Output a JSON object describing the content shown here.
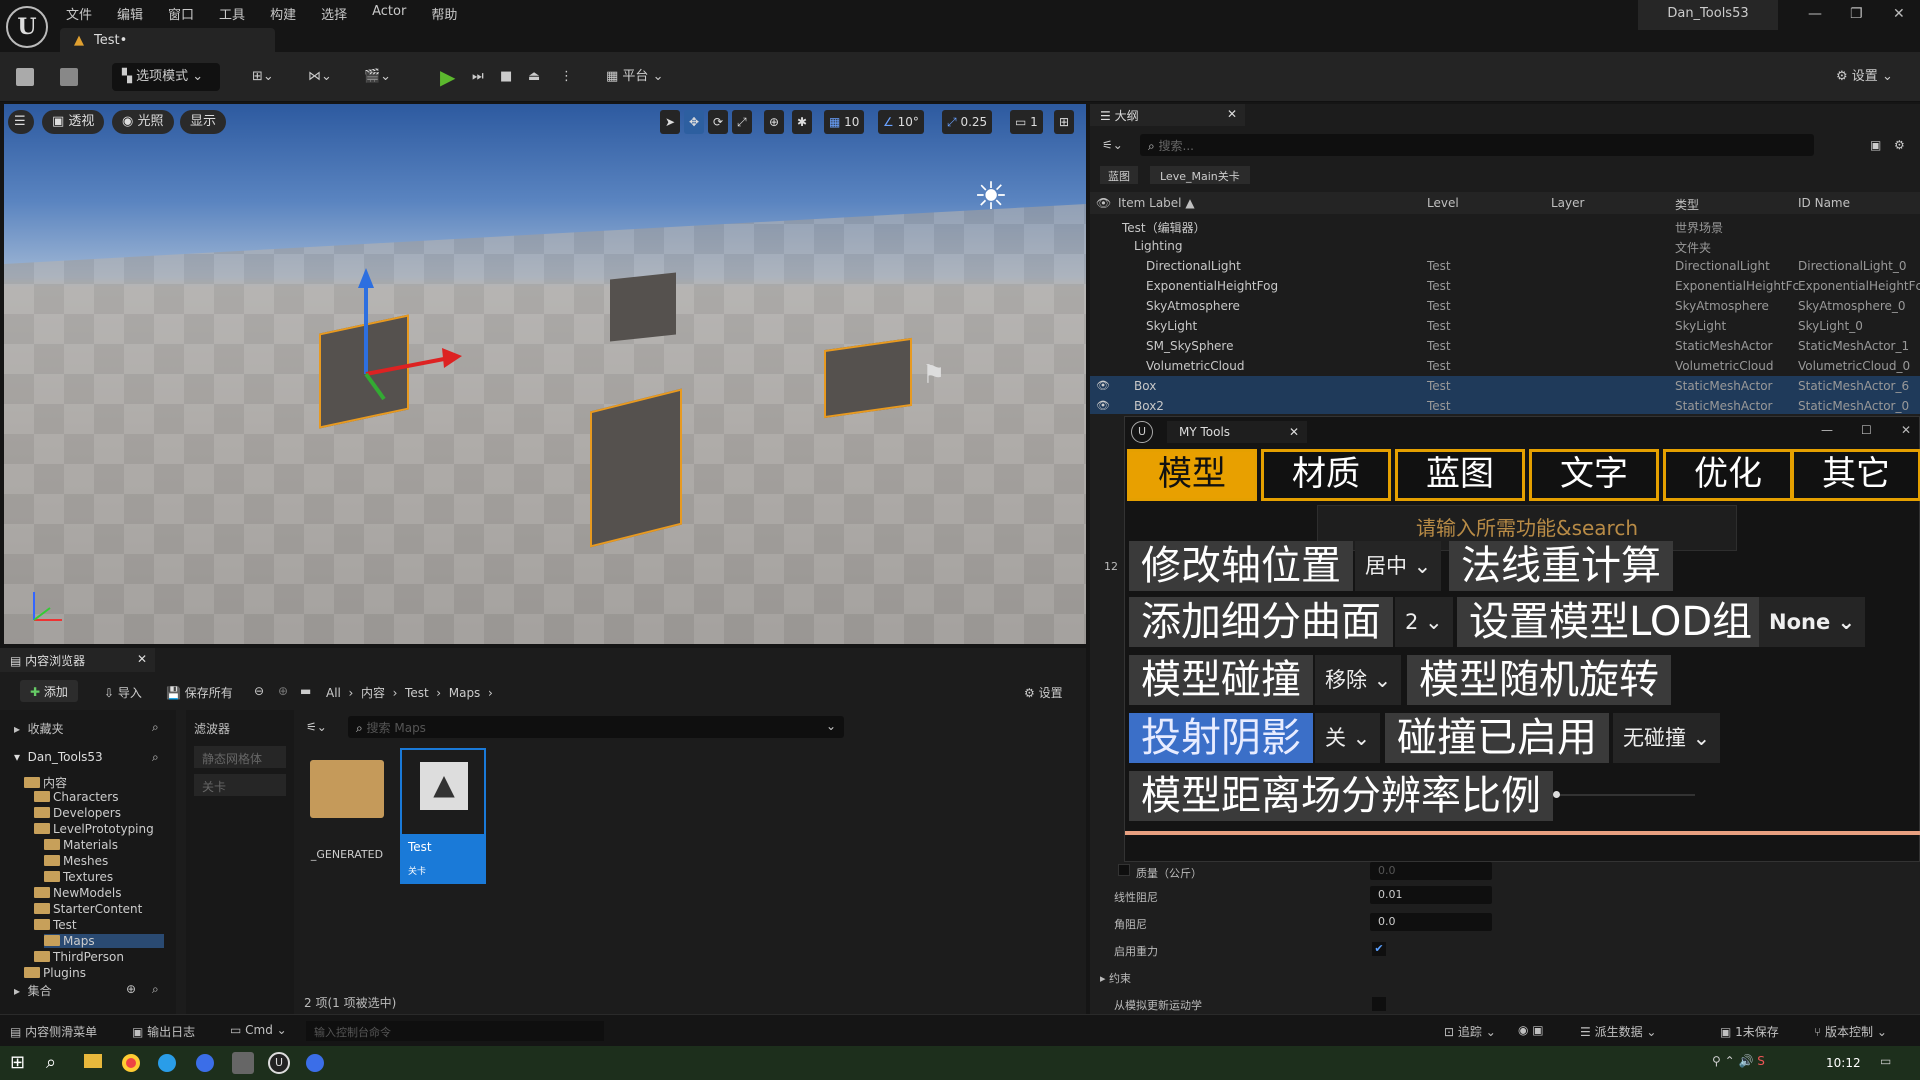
{
  "app": {
    "title_tab": "Test•",
    "project": "Dan_Tools53"
  },
  "menu": [
    "文件",
    "编辑",
    "窗口",
    "工具",
    "构建",
    "选择",
    "Actor",
    "帮助"
  ],
  "toolbar": {
    "mode": "选项模式",
    "platform": "平台",
    "settings": "设置"
  },
  "viewport": {
    "perspective": "透视",
    "lit": "光照",
    "show": "显示",
    "grid": "10",
    "angle": "10°",
    "scale": "0.25",
    "camera": "1"
  },
  "outliner": {
    "tab": "大纲",
    "search_placeholder": "搜索...",
    "filters": [
      "蓝图",
      "Leve_Main关卡"
    ],
    "columns": [
      "Item Label",
      "Level",
      "Layer",
      "类型",
      "ID Name"
    ],
    "rows": [
      {
        "label": "Test（编辑器）",
        "level": "",
        "type": "世界场景",
        "id": "",
        "sel": false,
        "indent": 1
      },
      {
        "label": "Lighting",
        "level": "",
        "type": "文件夹",
        "id": "",
        "sel": false,
        "indent": 2
      },
      {
        "label": "DirectionalLight",
        "level": "Test",
        "type": "DirectionalLight",
        "id": "DirectionalLight_0",
        "sel": false,
        "indent": 3
      },
      {
        "label": "ExponentialHeightFog",
        "level": "Test",
        "type": "ExponentialHeightFc",
        "id": "ExponentialHeightFc",
        "sel": false,
        "indent": 3
      },
      {
        "label": "SkyAtmosphere",
        "level": "Test",
        "type": "SkyAtmosphere",
        "id": "SkyAtmosphere_0",
        "sel": false,
        "indent": 3
      },
      {
        "label": "SkyLight",
        "level": "Test",
        "type": "SkyLight",
        "id": "SkyLight_0",
        "sel": false,
        "indent": 3
      },
      {
        "label": "SM_SkySphere",
        "level": "Test",
        "type": "StaticMeshActor",
        "id": "StaticMeshActor_1",
        "sel": false,
        "indent": 3
      },
      {
        "label": "VolumetricCloud",
        "level": "Test",
        "type": "VolumetricCloud",
        "id": "VolumetricCloud_0",
        "sel": false,
        "indent": 3
      },
      {
        "label": "Box",
        "level": "Test",
        "type": "StaticMeshActor",
        "id": "StaticMeshActor_6",
        "sel": true,
        "indent": 2
      },
      {
        "label": "Box2",
        "level": "Test",
        "type": "StaticMeshActor",
        "id": "StaticMeshActor_0",
        "sel": true,
        "indent": 2
      }
    ]
  },
  "details": {
    "mass": "质量（公斤）",
    "mass_val": "0.0",
    "linear_damping": "线性阻尼",
    "linear_val": "0.01",
    "angular_damping": "角阻尼",
    "angular_val": "0.0",
    "gravity": "启用重力",
    "constraints": "约束",
    "update_kinematic": "从模拟更新运动学",
    "side_num": "12"
  },
  "mytools": {
    "title": "MY Tools",
    "tabs": [
      "模型",
      "材质",
      "蓝图",
      "文字",
      "优化",
      "其它"
    ],
    "search_placeholder": "请输入所需功能&search",
    "fn": {
      "pivot": "修改轴位置",
      "pivot_dd": "居中",
      "normal": "法线重计算",
      "subdiv": "添加细分曲面",
      "subdiv_dd": "2",
      "lod": "设置模型LOD组",
      "lod_dd": "None",
      "collision": "模型碰撞",
      "collision_dd": "移除",
      "rotate": "模型随机旋转",
      "shadow": "投射阴影",
      "shadow_dd": "关",
      "coll_enabled": "碰撞已启用",
      "coll_dd": "无碰撞",
      "distfield": "模型距离场分辨率比例"
    }
  },
  "cb": {
    "tab": "内容浏览器",
    "add": "添加",
    "import": "导入",
    "save_all": "保存所有",
    "settings": "设置",
    "breadcrumb": [
      "All",
      "内容",
      "Test",
      "Maps"
    ],
    "favorites": "收藏夹",
    "project": "Dan_Tools53",
    "filters": "滤波器",
    "filter_items": [
      "静态网格体",
      "关卡"
    ],
    "search_placeholder": "搜索 Maps",
    "tree": [
      "内容",
      "Characters",
      "Developers",
      "LevelPrototyping",
      "Materials",
      "Meshes",
      "Textures",
      "NewModels",
      "StarterContent",
      "Test",
      "Maps",
      "ThirdPerson",
      "Plugins"
    ],
    "collections": "集合",
    "assets": [
      {
        "name": "_GENERATED"
      },
      {
        "name": "Test",
        "sub": "关卡"
      }
    ],
    "status": "2 项(1 项被选中)"
  },
  "statusbar": {
    "drawer": "内容侧滑菜单",
    "log": "输出日志",
    "cmd": "Cmd",
    "cmd_placeholder": "输入控制台命令",
    "trace": "追踪",
    "derived": "派生数据",
    "unsaved": "1未保存",
    "vc": "版本控制"
  },
  "taskbar": {
    "time": "10:12"
  }
}
